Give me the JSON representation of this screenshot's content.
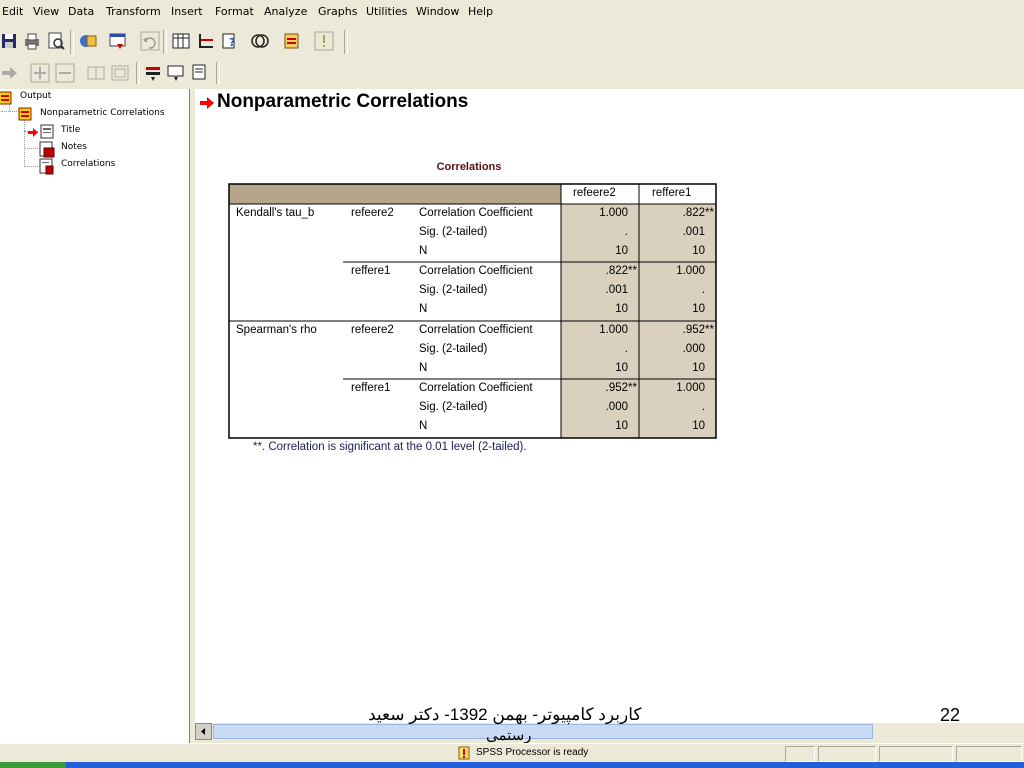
{
  "menu": [
    "Edit",
    "View",
    "Data",
    "Transform",
    "Insert",
    "Format",
    "Analyze",
    "Graphs",
    "Utilities",
    "Window",
    "Help"
  ],
  "tree": {
    "root": "Output",
    "section": "Nonparametric Correlations",
    "items": [
      "Title",
      "Notes",
      "Correlations"
    ]
  },
  "output": {
    "heading": "Nonparametric Correlations",
    "table_title": "Correlations",
    "columns": [
      "refeere2",
      "reffere1"
    ],
    "groups": [
      {
        "method": "Kendall's tau_b",
        "rows": [
          {
            "var": "refeere2",
            "stats": [
              {
                "label": "Correlation Coefficient",
                "v1": "1.000",
                "v2": ".822**"
              },
              {
                "label": "Sig. (2-tailed)",
                "v1": ".",
                "v2": ".001"
              },
              {
                "label": "N",
                "v1": "10",
                "v2": "10"
              }
            ]
          },
          {
            "var": "reffere1",
            "stats": [
              {
                "label": "Correlation Coefficient",
                "v1": ".822**",
                "v2": "1.000"
              },
              {
                "label": "Sig. (2-tailed)",
                "v1": ".001",
                "v2": "."
              },
              {
                "label": "N",
                "v1": "10",
                "v2": "10"
              }
            ]
          }
        ]
      },
      {
        "method": "Spearman's rho",
        "rows": [
          {
            "var": "refeere2",
            "stats": [
              {
                "label": "Correlation Coefficient",
                "v1": "1.000",
                "v2": ".952**"
              },
              {
                "label": "Sig. (2-tailed)",
                "v1": ".",
                "v2": ".000"
              },
              {
                "label": "N",
                "v1": "10",
                "v2": "10"
              }
            ]
          },
          {
            "var": "reffere1",
            "stats": [
              {
                "label": "Correlation Coefficient",
                "v1": ".952**",
                "v2": "1.000"
              },
              {
                "label": "Sig. (2-tailed)",
                "v1": ".000",
                "v2": "."
              },
              {
                "label": "N",
                "v1": "10",
                "v2": "10"
              }
            ]
          }
        ]
      }
    ],
    "footnote": "**. Correlation is significant at the 0.01 level (2-tailed)."
  },
  "slide": {
    "caption_line1": "کاربرد کامپیوتر- بهمن 1392- دکتر سعید",
    "caption_line2": "رستمی",
    "page_number": "22"
  },
  "status": {
    "processor": "SPSS Processor  is ready"
  },
  "colors": {
    "table_header_fill": "#b5a58a",
    "data_cell_fill": "#d9d0be",
    "arrow_red": "#ff0000",
    "title_color": "#5a1010"
  }
}
